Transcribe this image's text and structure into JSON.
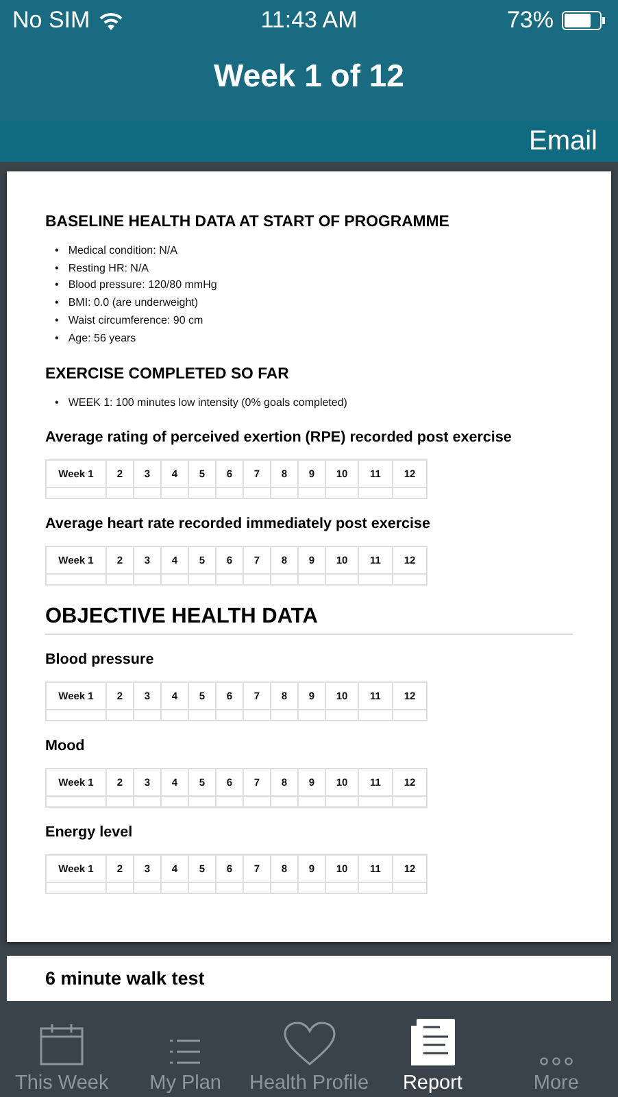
{
  "status_bar": {
    "carrier": "No SIM",
    "time": "11:43 AM",
    "battery": "73%"
  },
  "nav": {
    "title": "Week 1 of 12",
    "action": "Email"
  },
  "report": [
    {
      "kind": "heading",
      "text": "BASELINE HEALTH DATA AT START OF PROGRAMME"
    },
    {
      "kind": "bullets",
      "marker": "•",
      "items": [
        "Medical condition: N/A",
        "Resting HR: N/A",
        "Blood pressure: 120/80 mmHg",
        "BMI: 0.0 (are underweight)",
        "Waist circumference: 90 cm",
        "Age: 56 years"
      ]
    },
    {
      "kind": "heading",
      "text": "EXERCISE COMPLETED SO FAR"
    },
    {
      "kind": "bullets",
      "marker": "•",
      "items": [
        "WEEK 1: 100 minutes low intensity (0% goals completed)"
      ]
    },
    {
      "kind": "subheading",
      "text": "Average rating of perceived exertion (RPE) recorded post exercise"
    },
    {
      "kind": "table",
      "columns": [
        "Week 1",
        "2",
        "3",
        "4",
        "5",
        "6",
        "7",
        "8",
        "9",
        "10",
        "11",
        "12"
      ]
    },
    {
      "kind": "subheading",
      "text": "Average heart rate recorded immediately post exercise"
    },
    {
      "kind": "table",
      "columns": [
        "Week 1",
        "2",
        "3",
        "4",
        "5",
        "6",
        "7",
        "8",
        "9",
        "10",
        "11",
        "12"
      ]
    },
    {
      "kind": "major",
      "text": "OBJECTIVE HEALTH DATA"
    },
    {
      "kind": "subheading",
      "text": "Blood pressure"
    },
    {
      "kind": "table",
      "columns": [
        "Week 1",
        "2",
        "3",
        "4",
        "5",
        "6",
        "7",
        "8",
        "9",
        "10",
        "11",
        "12"
      ]
    },
    {
      "kind": "subheading",
      "text": "Mood"
    },
    {
      "kind": "table",
      "columns": [
        "Week 1",
        "2",
        "3",
        "4",
        "5",
        "6",
        "7",
        "8",
        "9",
        "10",
        "11",
        "12"
      ]
    },
    {
      "kind": "subheading",
      "text": "Energy level"
    },
    {
      "kind": "table",
      "columns": [
        "Week 1",
        "2",
        "3",
        "4",
        "5",
        "6",
        "7",
        "8",
        "9",
        "10",
        "11",
        "12"
      ]
    }
  ],
  "next_card": {
    "title": "6 minute walk test"
  },
  "tabs": [
    {
      "label": "This Week",
      "selected": false
    },
    {
      "label": "My Plan",
      "selected": false
    },
    {
      "label": "Health Profile",
      "selected": false
    },
    {
      "label": "Report",
      "selected": true
    },
    {
      "label": "More",
      "selected": false
    }
  ]
}
